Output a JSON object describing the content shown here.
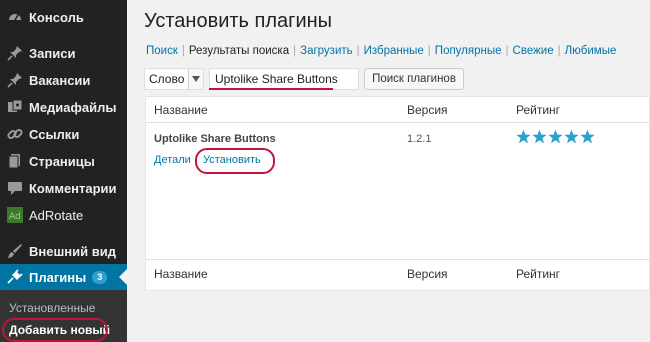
{
  "sidebar": {
    "items": [
      {
        "id": "console",
        "label": "Консоль",
        "icon": "dashboard-icon"
      },
      {
        "id": "posts",
        "label": "Записи",
        "icon": "pin-icon"
      },
      {
        "id": "vacancies",
        "label": "Вакансии",
        "icon": "pin-icon"
      },
      {
        "id": "media",
        "label": "Медиафайлы",
        "icon": "media-icon"
      },
      {
        "id": "links",
        "label": "Ссылки",
        "icon": "link-icon"
      },
      {
        "id": "pages",
        "label": "Страницы",
        "icon": "page-icon"
      },
      {
        "id": "comments",
        "label": "Комментарии",
        "icon": "comment-icon"
      },
      {
        "id": "adrotate",
        "label": "AdRotate",
        "icon": "adrotate-icon"
      },
      {
        "id": "appearance",
        "label": "Внешний вид",
        "icon": "brush-icon"
      },
      {
        "id": "plugins",
        "label": "Плагины",
        "icon": "plugin-icon",
        "badge": "3"
      }
    ],
    "submenu": {
      "installed": "Установленные",
      "add_new": "Добавить новый"
    }
  },
  "main": {
    "title": "Установить плагины",
    "tabs": [
      {
        "label": "Поиск",
        "current": false
      },
      {
        "label": "Результаты поиска",
        "current": true
      },
      {
        "label": "Загрузить",
        "current": false
      },
      {
        "label": "Избранные",
        "current": false
      },
      {
        "label": "Популярные",
        "current": false
      },
      {
        "label": "Свежие",
        "current": false
      },
      {
        "label": "Любимые",
        "current": false
      }
    ],
    "search": {
      "type_value": "Слово",
      "query": "Uptolike Share Buttons",
      "button_label": "Поиск плагинов"
    },
    "table": {
      "col_name": "Название",
      "col_version": "Версия",
      "col_rating": "Рейтинг",
      "rows": [
        {
          "name": "Uptolike Share Buttons",
          "version": "1.2.1",
          "rating_stars": 5,
          "details_label": "Детали",
          "install_label": "Установить"
        }
      ]
    }
  },
  "colors": {
    "sidebar_bg": "#222222",
    "active_menu": "#0074a2",
    "link": "#0074a2",
    "highlight": "#c0143c",
    "star": "#2ea2cc"
  }
}
